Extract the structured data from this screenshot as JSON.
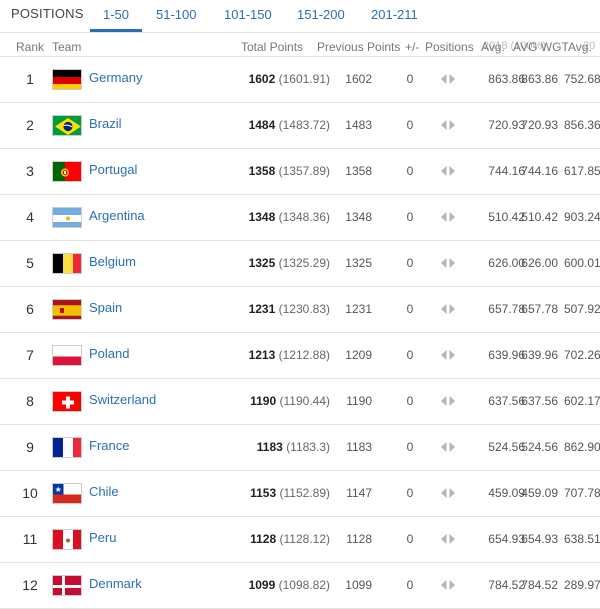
{
  "tabs": {
    "title": "POSITIONS",
    "items": [
      "1-50",
      "51-100",
      "101-150",
      "151-200",
      "201-211"
    ],
    "active": "1-50"
  },
  "columns": {
    "rank": "Rank",
    "team": "Team",
    "total": "Total Points",
    "previous": "Previous Points",
    "change": "+/-",
    "positions": "Positions",
    "avg": "Avg.",
    "avg_wgt": "AVG WGT",
    "clipped_a": "2018 (100%)",
    "clipped_b": "20"
  },
  "rows": [
    {
      "rank": "1",
      "team": "Germany",
      "total": "1602",
      "total_precise": "(1601.91)",
      "previous": "1602",
      "change": "0",
      "avg": "863.86",
      "avg_wgt": "863.86",
      "next": "752.68"
    },
    {
      "rank": "2",
      "team": "Brazil",
      "total": "1484",
      "total_precise": "(1483.72)",
      "previous": "1483",
      "change": "0",
      "avg": "720.93",
      "avg_wgt": "720.93",
      "next": "856.36"
    },
    {
      "rank": "3",
      "team": "Portugal",
      "total": "1358",
      "total_precise": "(1357.89)",
      "previous": "1358",
      "change": "0",
      "avg": "744.16",
      "avg_wgt": "744.16",
      "next": "617.85"
    },
    {
      "rank": "4",
      "team": "Argentina",
      "total": "1348",
      "total_precise": "(1348.36)",
      "previous": "1348",
      "change": "0",
      "avg": "510.42",
      "avg_wgt": "510.42",
      "next": "903.24"
    },
    {
      "rank": "5",
      "team": "Belgium",
      "total": "1325",
      "total_precise": "(1325.29)",
      "previous": "1325",
      "change": "0",
      "avg": "626.00",
      "avg_wgt": "626.00",
      "next": "600.01"
    },
    {
      "rank": "6",
      "team": "Spain",
      "total": "1231",
      "total_precise": "(1230.83)",
      "previous": "1231",
      "change": "0",
      "avg": "657.78",
      "avg_wgt": "657.78",
      "next": "507.92"
    },
    {
      "rank": "7",
      "team": "Poland",
      "total": "1213",
      "total_precise": "(1212.88)",
      "previous": "1209",
      "change": "0",
      "avg": "639.96",
      "avg_wgt": "639.96",
      "next": "702.26"
    },
    {
      "rank": "8",
      "team": "Switzerland",
      "total": "1190",
      "total_precise": "(1190.44)",
      "previous": "1190",
      "change": "0",
      "avg": "637.56",
      "avg_wgt": "637.56",
      "next": "602.17"
    },
    {
      "rank": "9",
      "team": "France",
      "total": "1183",
      "total_precise": "(1183.3)",
      "previous": "1183",
      "change": "0",
      "avg": "524.56",
      "avg_wgt": "524.56",
      "next": "862.90"
    },
    {
      "rank": "10",
      "team": "Chile",
      "total": "1153",
      "total_precise": "(1152.89)",
      "previous": "1147",
      "change": "0",
      "avg": "459.09",
      "avg_wgt": "459.09",
      "next": "707.78"
    },
    {
      "rank": "11",
      "team": "Peru",
      "total": "1128",
      "total_precise": "(1128.12)",
      "previous": "1128",
      "change": "0",
      "avg": "654.93",
      "avg_wgt": "654.93",
      "next": "638.51"
    },
    {
      "rank": "12",
      "team": "Denmark",
      "total": "1099",
      "total_precise": "(1098.82)",
      "previous": "1099",
      "change": "0",
      "avg": "784.52",
      "avg_wgt": "784.52",
      "next": "289.97"
    }
  ],
  "flags": [
    "germany-flag",
    "brazil-flag",
    "portugal-flag",
    "argentina-flag",
    "belgium-flag",
    "spain-flag",
    "poland-flag",
    "switzerland-flag",
    "france-flag",
    "chile-flag",
    "peru-flag",
    "denmark-flag"
  ],
  "colors": {
    "link": "#2a6fb5",
    "arrow": "#b5b5b5"
  }
}
